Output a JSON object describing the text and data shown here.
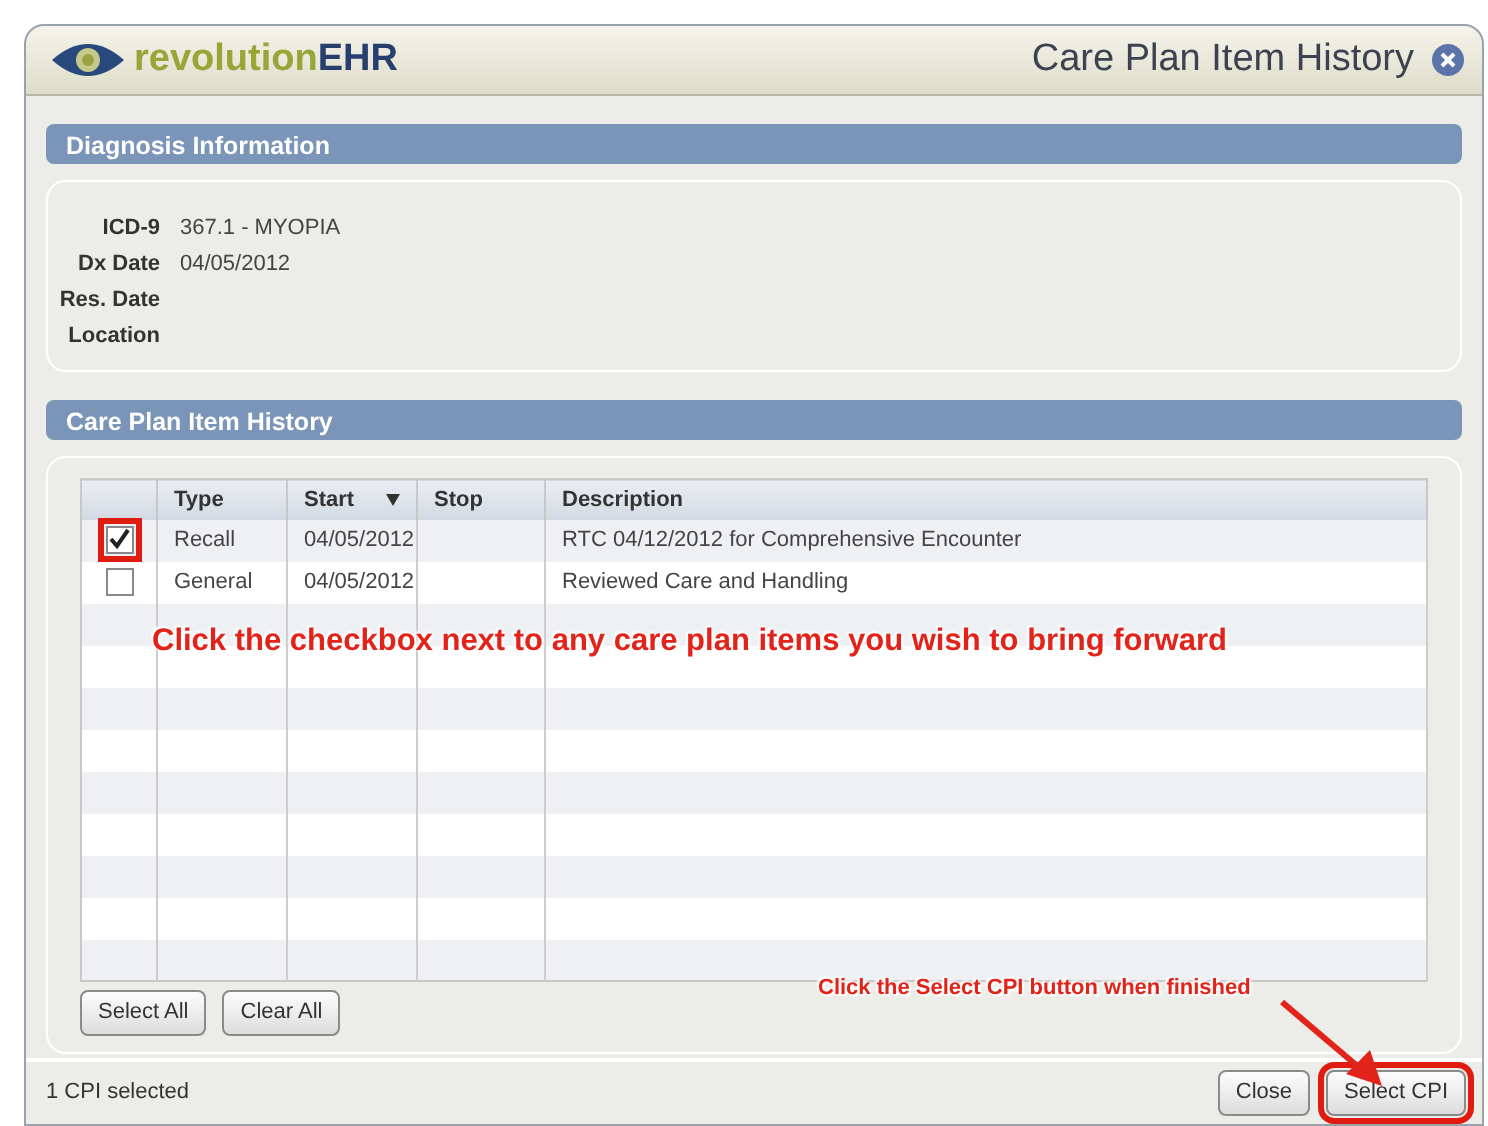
{
  "window": {
    "brand": "revolution**EHR**",
    "title": "Care Plan Item History"
  },
  "diagnosis": {
    "header": "Diagnosis Information",
    "fields": [
      {
        "label": "ICD-9",
        "value": "367.1 - MYOPIA"
      },
      {
        "label": "Dx Date",
        "value": "04/05/2012"
      },
      {
        "label": "Res. Date"
      },
      {
        "label": "Location"
      }
    ]
  },
  "history": {
    "header": "Care Plan Item History",
    "columns": [
      {
        "label": "Type"
      },
      {
        "label": "Start",
        "sorted": true
      },
      {
        "label": "Stop"
      },
      {
        "label": "Description"
      }
    ],
    "rows": [
      {
        "checked": true,
        "type": "Recall",
        "start": "04/05/2012",
        "description": "RTC 04/12/2012 for Comprehensive Encounter"
      },
      {
        "checked": false,
        "type": "General",
        "start": "04/05/2012",
        "description": "Reviewed Care and Handling"
      }
    ],
    "buttons": [
      "Select All",
      "Clear All"
    ]
  },
  "status_bar": "1 CPI selected",
  "buttons": [
    {
      "label": "Close",
      "highlighted": false
    },
    {
      "label": "Select CPI",
      "highlighted": true
    }
  ],
  "annotations": [
    "Click the checkbox next to any care plan items you wish to bring forward",
    "Click the Select CPI button when finished"
  ]
}
